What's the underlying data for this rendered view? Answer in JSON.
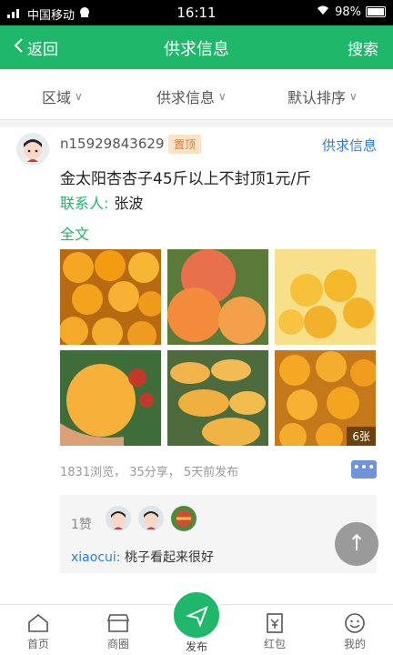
{
  "status_bar": {
    "carrier": "中国移动",
    "time": "16:11",
    "battery": "98%",
    "signal_icon": "signal-icon",
    "wifi_icon": "wifi-icon"
  },
  "nav": {
    "back_label": "返回",
    "title": "供求信息",
    "search_label": "搜索"
  },
  "filters": [
    {
      "label": "区域"
    },
    {
      "label": "供求信息"
    },
    {
      "label": "默认排序"
    }
  ],
  "post": {
    "username": "n15929843629",
    "badge": "置顶",
    "type": "供求信息",
    "title": "金太阳杏杏子45斤以上不封顶1元/斤",
    "contact_label": "联系人:",
    "contact_name": "张波",
    "fulltext_label": "全文",
    "photo_count": "6张",
    "stats": "1831浏览， 35分享， 5天前发布",
    "likes": "1赞",
    "comment_user": "xiaocui:",
    "comment_text": "桃子看起来很好"
  },
  "tabbar": {
    "home": "首页",
    "mall": "商圈",
    "publish": "发布",
    "redpacket": "红包",
    "mine": "我的"
  },
  "colors": {
    "brand_green": "#1fb86a",
    "link_blue": "#2f7fd8",
    "badge_orange": "#e07a2f"
  }
}
